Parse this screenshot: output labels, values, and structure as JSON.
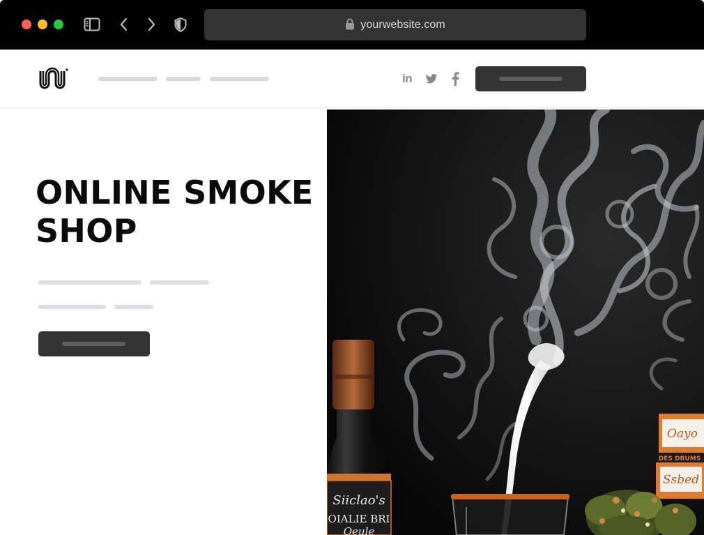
{
  "browser": {
    "url": "yourwebsite.com",
    "icons": [
      "sidebar-icon",
      "back-icon",
      "forward-icon",
      "shield-icon",
      "lock-icon"
    ]
  },
  "nav": {
    "logo": "logo",
    "social_icons": [
      "linkedin-icon",
      "twitter-icon",
      "facebook-icon"
    ],
    "linkedin_text": "in"
  },
  "hero": {
    "title": "ONLINE SMOKE SHOP",
    "image": {
      "bottle_label_line1": "Siiclao's",
      "bottle_label_line2": "OIALIE BRI",
      "bottle_label_line3": "Oeule",
      "box_label_top": "Oayo",
      "box_label_mid": "DES DRUMS",
      "box_label_bottom": "Ssbed"
    }
  },
  "colors": {
    "chrome_bg": "#000000",
    "urlbar_bg": "#333333",
    "button_bg": "#333333",
    "placeholder_line": "#dcdce4",
    "title_color": "#0b0b0b"
  }
}
